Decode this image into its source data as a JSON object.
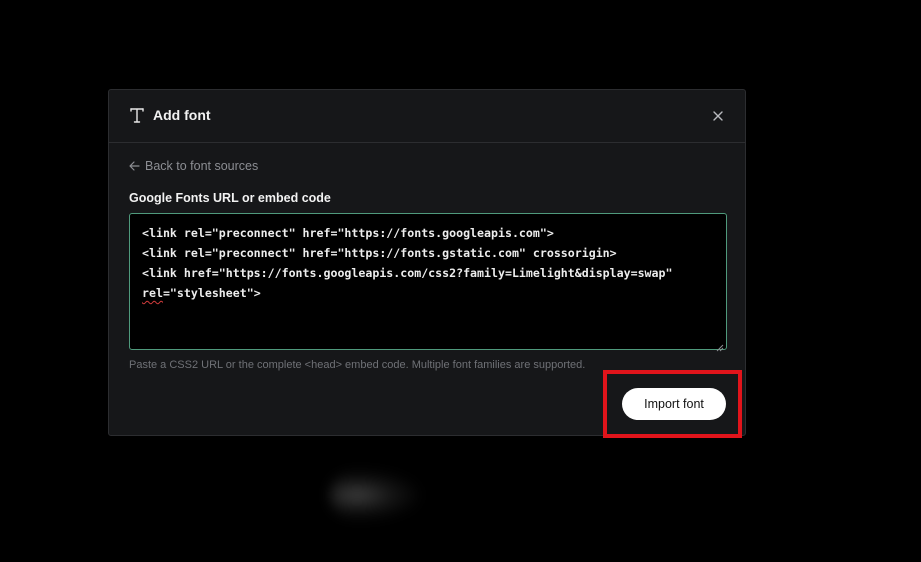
{
  "modal": {
    "title": "Add font",
    "title_icon": "type-icon",
    "close_icon": "close-icon",
    "back_link": {
      "icon": "arrow-left-icon",
      "label": "Back to font sources"
    },
    "field_label": "Google Fonts URL or embed code",
    "code_lines": {
      "l1": "<link rel=\"preconnect\" href=\"https://fonts.googleapis.com\">",
      "l2": "<link rel=\"preconnect\" href=\"https://fonts.gstatic.com\" crossorigin>",
      "l3": "<link href=\"https://fonts.googleapis.com/css2?family=Limelight&display=swap\"",
      "l4_a": "rel",
      "l4_b": "=\"stylesheet\">"
    },
    "hint": "Paste a CSS2 URL or the complete <head> embed code. Multiple font families are supported.",
    "import_button": "Import font"
  },
  "colors": {
    "background": "#000000",
    "modal_bg": "#161719",
    "focus_border": "#4f9a7c",
    "highlight": "#e0141b",
    "button_bg": "#ffffff"
  }
}
